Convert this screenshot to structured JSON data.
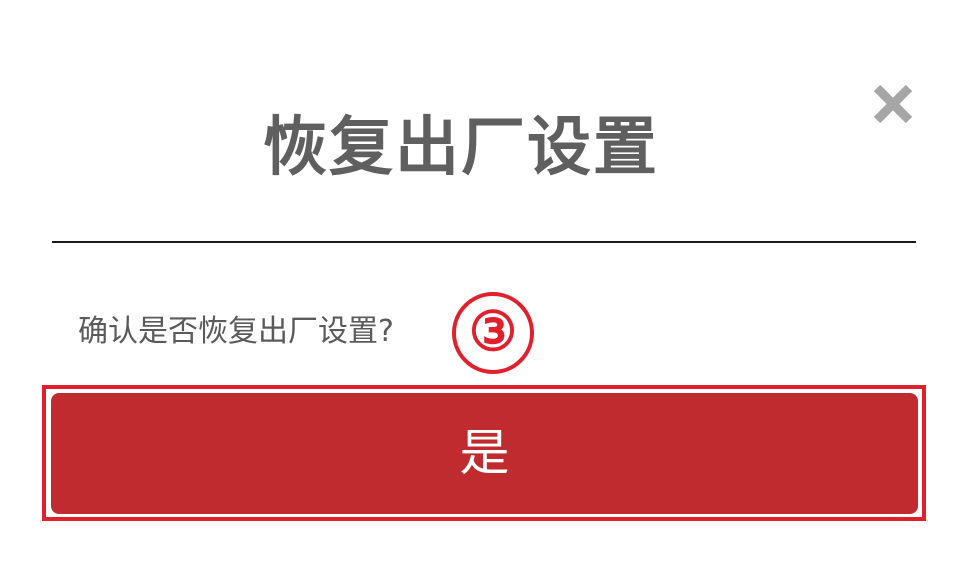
{
  "dialog": {
    "title": "恢复出厂设置",
    "message": "确认是否恢复出厂设置?",
    "confirm_label": "是",
    "close_icon": "close-icon"
  },
  "annotation": {
    "step_marker": "③",
    "highlight_color": "#e0202c"
  },
  "colors": {
    "button_bg": "#c02b2f",
    "title_text": "#5f5f5f",
    "close_icon": "#a6a6a6"
  }
}
